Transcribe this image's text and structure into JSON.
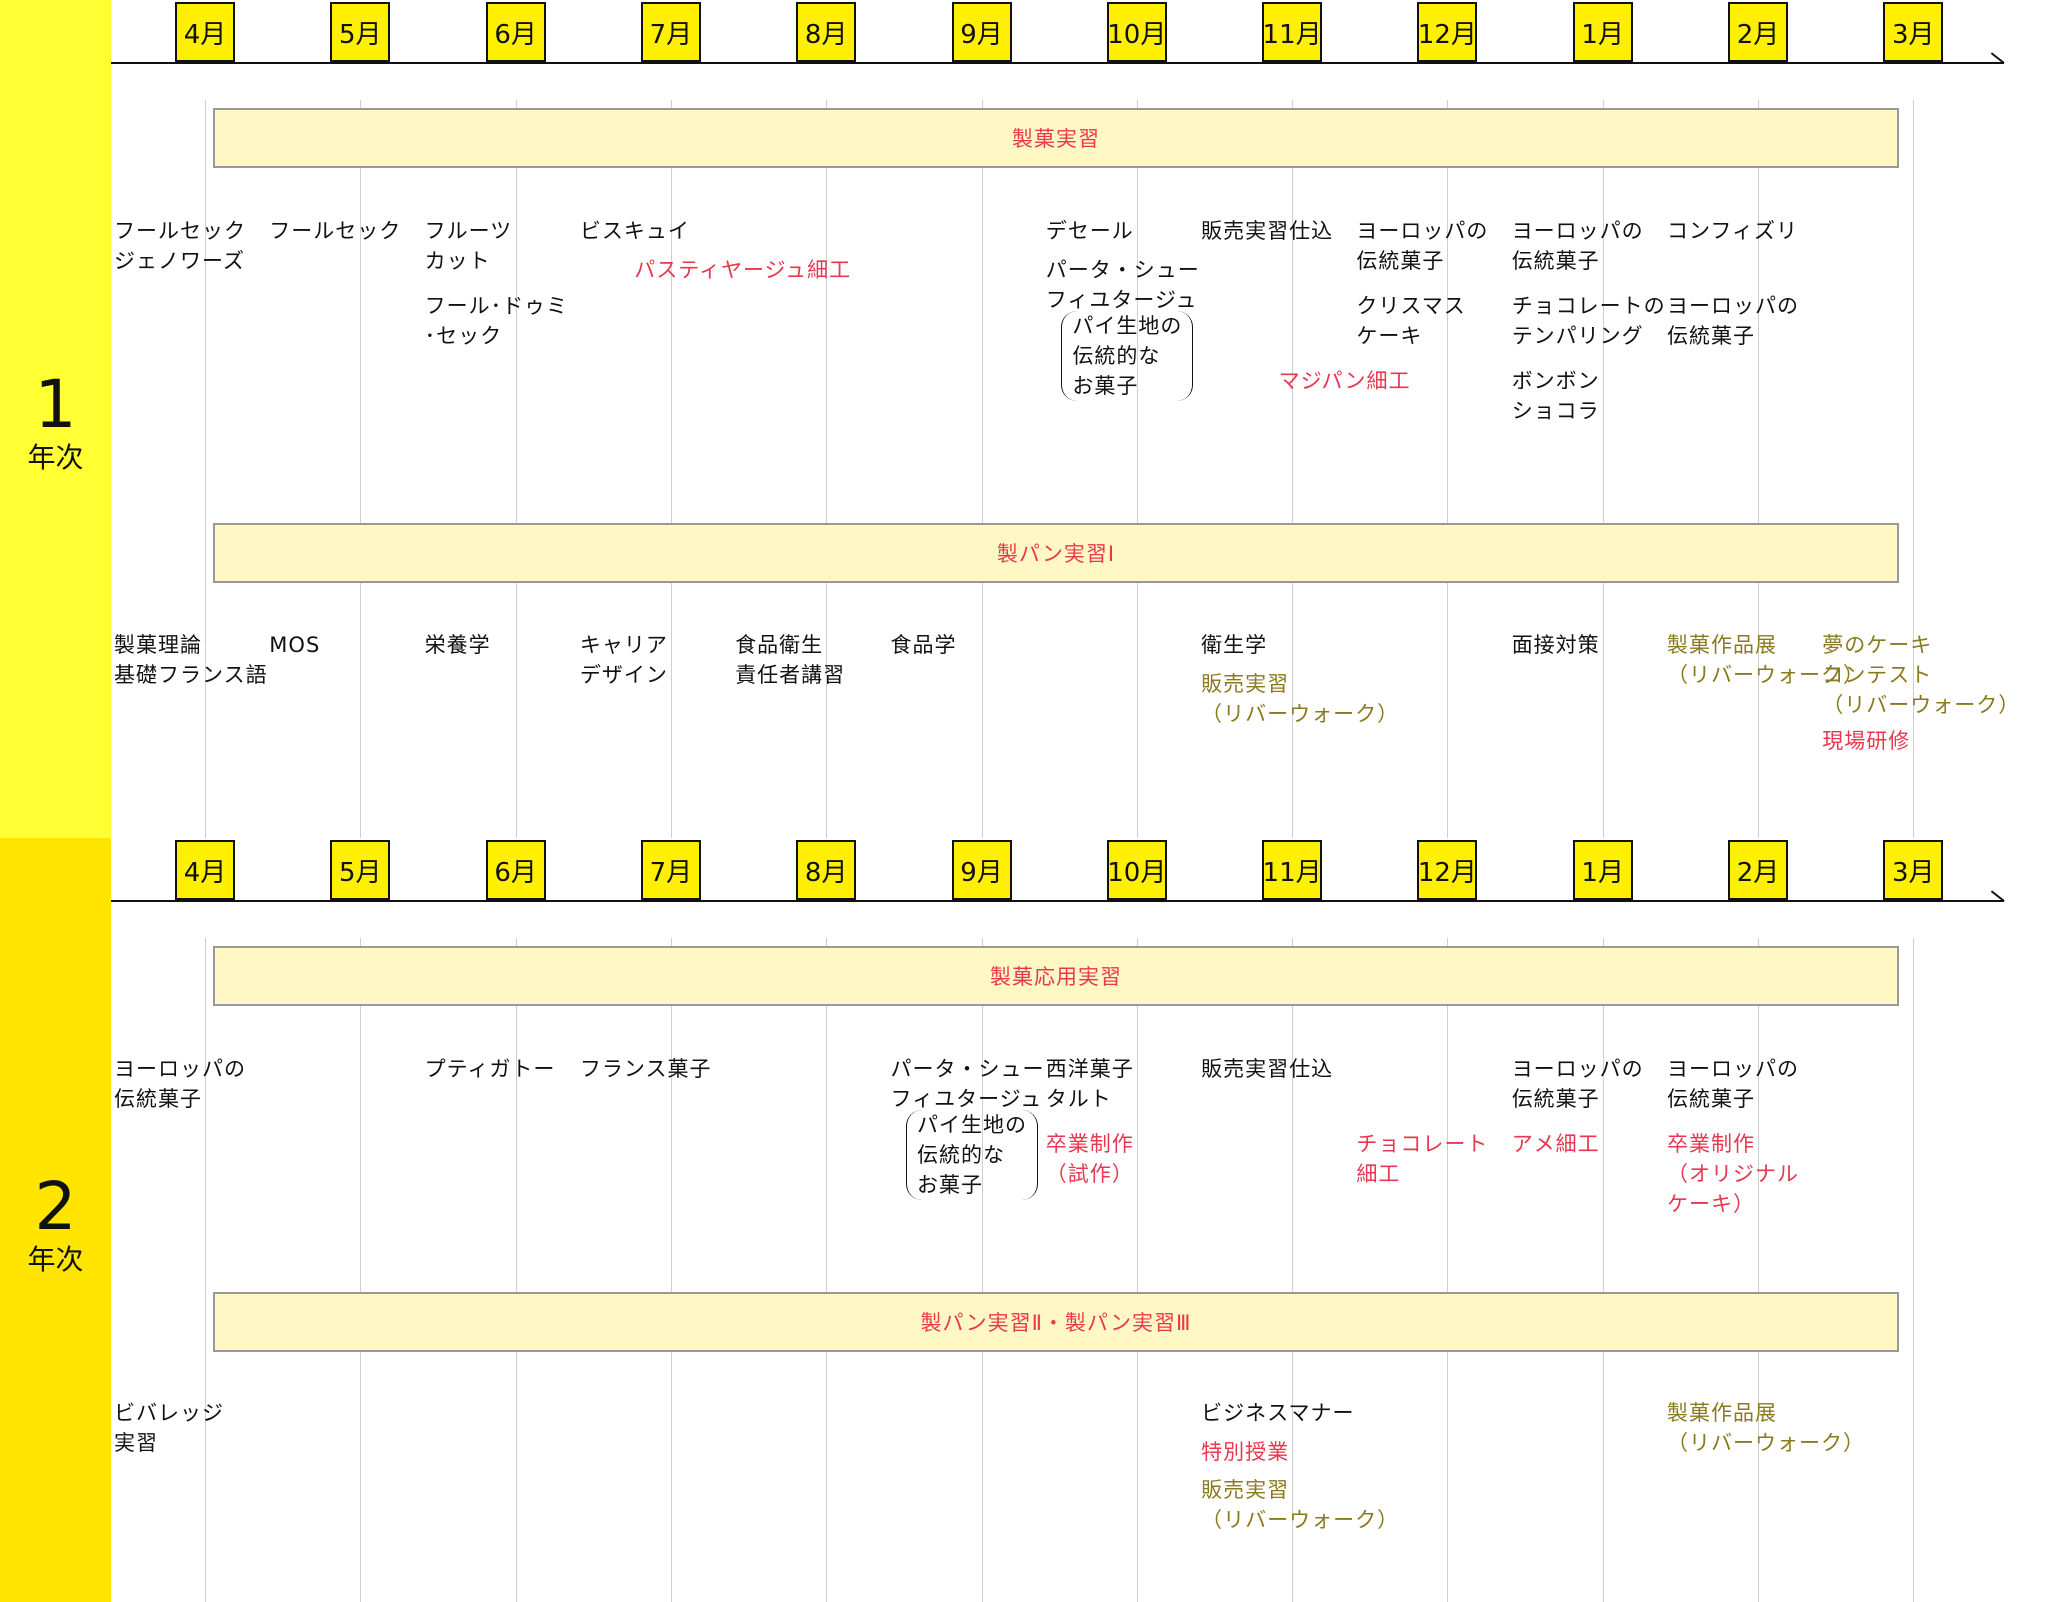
{
  "months": [
    "4月",
    "5月",
    "6月",
    "7月",
    "8月",
    "9月",
    "10月",
    "11月",
    "12月",
    "1月",
    "2月",
    "3月"
  ],
  "year1": {
    "num": "1",
    "word": "年次",
    "band_top": "製菓実習",
    "band_bottom": "製パン実習Ⅰ",
    "top_items": [
      {
        "col": 0,
        "row": 0,
        "text": "フールセック\nジェノワーズ",
        "color": "black"
      },
      {
        "col": 1,
        "row": 0,
        "text": "フールセック",
        "color": "black"
      },
      {
        "col": 2,
        "row": 0,
        "text": "フルーツ\nカット",
        "color": "black"
      },
      {
        "col": 2,
        "row": 2.5,
        "text": "フール･ドゥミ\n･セック",
        "color": "black"
      },
      {
        "col": 3,
        "row": 0,
        "text": "ビスキュイ",
        "color": "black"
      },
      {
        "col": 3.35,
        "row": 1.3,
        "text": "パスティヤージュ細工",
        "color": "pink"
      },
      {
        "col": 6,
        "row": 0,
        "text": "デセール",
        "color": "black"
      },
      {
        "col": 6,
        "row": 1.3,
        "text": "パータ・シュー\nフィユタージュ",
        "color": "black"
      },
      {
        "col": 6.1,
        "row": 3.15,
        "text": "パイ生地の\n伝統的な\nお菓子",
        "color": "black",
        "paren": true
      },
      {
        "col": 7,
        "row": 0,
        "text": "販売実習仕込",
        "color": "black"
      },
      {
        "col": 7.5,
        "row": 5.0,
        "text": "マジパン細工",
        "color": "pink"
      },
      {
        "col": 8,
        "row": 0,
        "text": "ヨーロッパの\n伝統菓子",
        "color": "black"
      },
      {
        "col": 8,
        "row": 2.5,
        "text": "クリスマス\nケーキ",
        "color": "black"
      },
      {
        "col": 9,
        "row": 0,
        "text": "ヨーロッパの\n伝統菓子",
        "color": "black"
      },
      {
        "col": 9,
        "row": 2.5,
        "text": "チョコレートの\nテンパリング",
        "color": "black"
      },
      {
        "col": 9,
        "row": 5.0,
        "text": "ボンボン\nショコラ",
        "color": "black"
      },
      {
        "col": 10,
        "row": 0,
        "text": "コンフィズリ",
        "color": "black"
      },
      {
        "col": 10,
        "row": 2.5,
        "text": "ヨーロッパの\n伝統菓子",
        "color": "black"
      }
    ],
    "bottom_items": [
      {
        "col": 0,
        "row": 0,
        "text": "製菓理論\n基礎フランス語",
        "color": "black"
      },
      {
        "col": 1,
        "row": 0,
        "text": "MOS",
        "color": "black"
      },
      {
        "col": 2,
        "row": 0,
        "text": "栄養学",
        "color": "black"
      },
      {
        "col": 3,
        "row": 0,
        "text": "キャリア\nデザイン",
        "color": "black"
      },
      {
        "col": 4,
        "row": 0,
        "text": "食品衛生\n責任者講習",
        "color": "black"
      },
      {
        "col": 5,
        "row": 0,
        "text": "食品学",
        "color": "black"
      },
      {
        "col": 7,
        "row": 0,
        "text": "衛生学",
        "color": "black"
      },
      {
        "col": 7,
        "row": 1.3,
        "text": "販売実習\n（リバーウォーク）",
        "color": "olive"
      },
      {
        "col": 9,
        "row": 0,
        "text": "面接対策",
        "color": "black"
      },
      {
        "col": 10,
        "row": 0,
        "text": "製菓作品展\n（リバーウォーク）",
        "color": "olive"
      },
      {
        "col": 11,
        "row": 0,
        "text": "夢のケーキ\nコンテスト\n（リバーウォーク）",
        "color": "olive"
      },
      {
        "col": 11,
        "row": 3.2,
        "text": "現場研修",
        "color": "pink"
      }
    ]
  },
  "year2": {
    "num": "2",
    "word": "年次",
    "band_top": "製菓応用実習",
    "band_bottom": "製パン実習Ⅱ・製パン実習Ⅲ",
    "top_items": [
      {
        "col": 0,
        "row": 0,
        "text": "ヨーロッパの\n伝統菓子",
        "color": "black"
      },
      {
        "col": 2,
        "row": 0,
        "text": "プティガトー",
        "color": "black"
      },
      {
        "col": 3,
        "row": 0,
        "text": "フランス菓子",
        "color": "black"
      },
      {
        "col": 5,
        "row": 0,
        "text": "パータ・シュー\nフィユタージュ",
        "color": "black"
      },
      {
        "col": 5.1,
        "row": 1.85,
        "text": "パイ生地の\n伝統的な\nお菓子",
        "color": "black",
        "paren": true
      },
      {
        "col": 6,
        "row": 0,
        "text": "西洋菓子\nタルト",
        "color": "black"
      },
      {
        "col": 6,
        "row": 2.5,
        "text": "卒業制作\n（試作）",
        "color": "pink"
      },
      {
        "col": 7,
        "row": 0,
        "text": "販売実習仕込",
        "color": "black"
      },
      {
        "col": 8,
        "row": 2.5,
        "text": "チョコレート\n細工",
        "color": "pink"
      },
      {
        "col": 9,
        "row": 0,
        "text": "ヨーロッパの\n伝統菓子",
        "color": "black"
      },
      {
        "col": 9,
        "row": 2.5,
        "text": "アメ細工",
        "color": "pink"
      },
      {
        "col": 10,
        "row": 0,
        "text": "ヨーロッパの\n伝統菓子",
        "color": "black"
      },
      {
        "col": 10,
        "row": 2.5,
        "text": "卒業制作\n（オリジナル\nケーキ）",
        "color": "pink"
      }
    ],
    "bottom_items": [
      {
        "col": 0,
        "row": 0,
        "text": "ビバレッジ\n実習",
        "color": "black"
      },
      {
        "col": 7,
        "row": 0,
        "text": "ビジネスマナー",
        "color": "black"
      },
      {
        "col": 7,
        "row": 1.3,
        "text": "特別授業",
        "color": "pink"
      },
      {
        "col": 7,
        "row": 2.55,
        "text": "販売実習\n（リバーウォーク）",
        "color": "olive"
      },
      {
        "col": 10,
        "row": 0,
        "text": "製菓作品展\n（リバーウォーク）",
        "color": "olive"
      }
    ]
  },
  "colors": {
    "year1_bg": "#ffff33",
    "year2_bg": "#ffe500",
    "month_box": "#ffef00",
    "band_bg": "#fff8c4",
    "pink": "#e8374f",
    "olive": "#8a7a1e"
  }
}
